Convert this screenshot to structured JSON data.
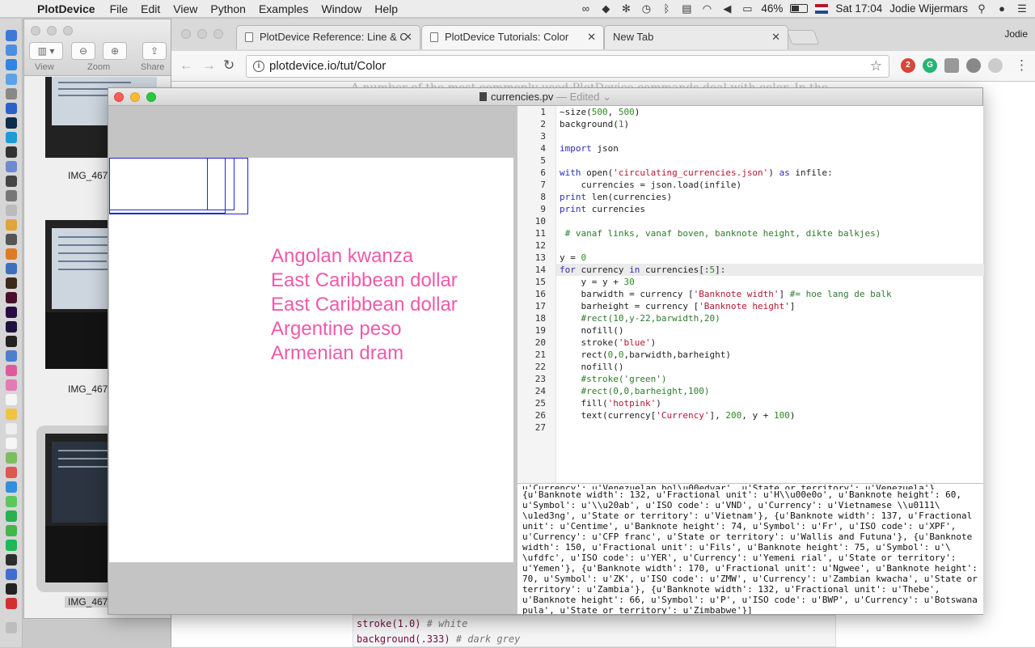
{
  "menubar": {
    "app_name": "PlotDevice",
    "menus": [
      "File",
      "Edit",
      "View",
      "Python",
      "Examples",
      "Window",
      "Help"
    ],
    "battery": "46%",
    "clock": "Sat 17:04",
    "user": "Jodie Wijermars"
  },
  "preview": {
    "tool_labels": [
      "View",
      "Zoom",
      "Share"
    ],
    "thumbnails": [
      "IMG_467",
      "IMG_467",
      "IMG_467"
    ]
  },
  "browser": {
    "tabs": [
      {
        "title": "PlotDevice Reference: Line & C",
        "active": false
      },
      {
        "title": "PlotDevice Tutorials: Color",
        "active": true
      },
      {
        "title": "New Tab",
        "active": false
      }
    ],
    "profile": "Jodie",
    "url": "plotdevice.io/tut/Color",
    "ext_badge": "2",
    "page_text": "A number of the most commonly used PlotDevice commands deal with color. In the",
    "snippet": [
      {
        "code": "stroke(1.0)",
        "comment": "# white"
      },
      {
        "code": "background(.333)",
        "comment": "# dark grey"
      }
    ]
  },
  "plotdevice": {
    "window_title": "currencies.pv",
    "title_suffix": "— Edited",
    "canvas": {
      "bars": [
        {
          "width": 122,
          "height": 65
        },
        {
          "width": 144,
          "height": 69
        },
        {
          "width": 155,
          "height": 65
        },
        {
          "width": 172,
          "height": 70
        }
      ],
      "currencies": [
        "Angolan kwanza",
        "East Caribbean dollar",
        "East Caribbean dollar",
        "Argentine peso",
        "Armenian dram"
      ],
      "text_color": "#f05aa8",
      "stroke_color": "#2323e0"
    },
    "code_lines": [
      "~size(500, 500)",
      "background(1)",
      "",
      "import json",
      "",
      "with open('circulating_currencies.json') as infile:",
      "    currencies = json.load(infile)",
      "print len(currencies)",
      "print currencies",
      "",
      " # vanaf links, vanaf boven, banknote height, dikte balkjes)",
      "",
      "y = 0",
      "for currency in currencies[:5]:",
      "    y = y + 30",
      "    barwidth = currency ['Banknote width'] #= hoe lang de balk",
      "    barheight = currency ['Banknote height']",
      "    #rect(10,y-22,barwidth,20)",
      "    nofill()",
      "    stroke('blue')",
      "    rect(0,0,barwidth,barheight)",
      "    nofill()",
      "    #stroke('green')",
      "    #rect(0,0,barheight,100)",
      "    fill('hotpink')",
      "    text(currency['Currency'], 200, y + 100)",
      ""
    ],
    "active_line": 14,
    "console_lines": [
      "u'Currency': u'Venezuelan bol\\u00edvar', u'State or territory': u'Venezuela'},",
      "{u'Banknote width': 132, u'Fractional unit': u'H\\\\u00e0o', u'Banknote height': 60,",
      "u'Symbol': u'\\\\u20ab', u'ISO code': u'VND', u'Currency': u'Vietnamese \\\\u0111\\",
      "\\u1ed3ng', u'State or territory': u'Vietnam'}, {u'Banknote width': 137, u'Fractional",
      "unit': u'Centime', u'Banknote height': 74, u'Symbol': u'Fr', u'ISO code': u'XPF',",
      "u'Currency': u'CFP franc', u'State or territory': u'Wallis and Futuna'}, {u'Banknote",
      "width': 150, u'Fractional unit': u'Fils', u'Banknote height': 75, u'Symbol': u'\\",
      "\\ufdfc', u'ISO code': u'YER', u'Currency': u'Yemeni rial', u'State or territory':",
      "u'Yemen'}, {u'Banknote width': 170, u'Fractional unit': u'Ngwee', u'Banknote height':",
      "70, u'Symbol': u'ZK', u'ISO code': u'ZMW', u'Currency': u'Zambian kwacha', u'State or",
      "territory': u'Zambia'}, {u'Banknote width': 132, u'Fractional unit': u'Thebe',",
      "u'Banknote height': 66, u'Symbol': u'P', u'ISO code': u'BWP', u'Currency': u'Botswana",
      "pula', u'State or territory': u'Zimbabwe'}]"
    ]
  }
}
